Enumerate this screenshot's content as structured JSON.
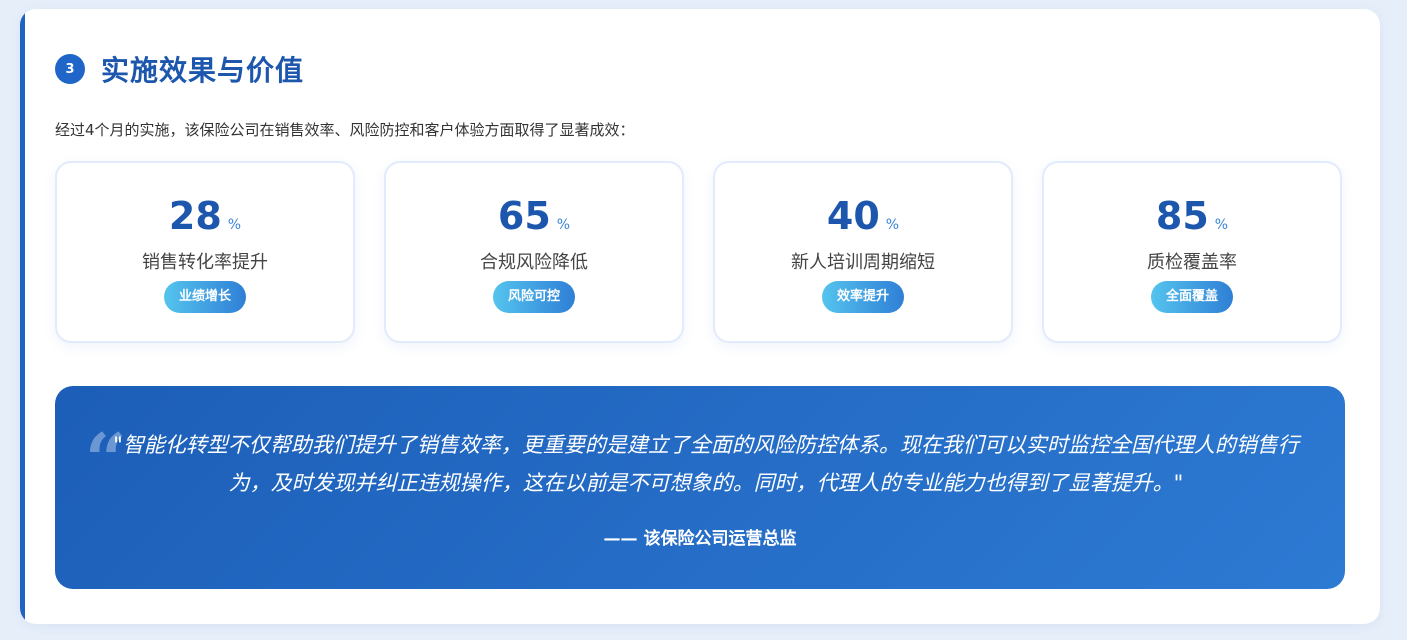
{
  "section": {
    "number": "3",
    "title": "实施效果与价值",
    "intro": "经过4个月的实施，该保险公司在销售效率、风险防控和客户体验方面取得了显著成效："
  },
  "stats": [
    {
      "value": "28",
      "unit": "%",
      "label": "销售转化率提升",
      "tag": "业绩增长"
    },
    {
      "value": "65",
      "unit": "%",
      "label": "合规风险降低",
      "tag": "风险可控"
    },
    {
      "value": "40",
      "unit": "%",
      "label": "新人培训周期缩短",
      "tag": "效率提升"
    },
    {
      "value": "85",
      "unit": "%",
      "label": "质检覆盖率",
      "tag": "全面覆盖"
    }
  ],
  "quote": {
    "mark": "“",
    "text": "\"智能化转型不仅帮助我们提升了销售效率，更重要的是建立了全面的风险防控体系。现在我们可以实时监控全国代理人的销售行为，及时发现并纠正违规操作，这在以前是不可想象的。同时，代理人的专业能力也得到了显著提升。\"",
    "author": "—— 该保险公司运营总监"
  },
  "colors": {
    "accent": "#1f63c2",
    "title": "#1d57ad",
    "tag_gradient_start": "#55c4ee",
    "tag_gradient_end": "#2f7fd6",
    "quote_bg_start": "#1c5eb8",
    "quote_bg_end": "#2d7ad3"
  }
}
